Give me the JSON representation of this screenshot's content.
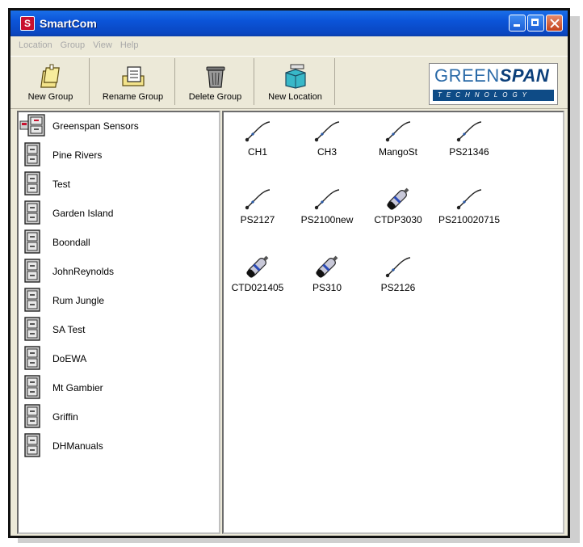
{
  "window": {
    "title": "SmartCom",
    "icon": "smartcom-app-icon"
  },
  "menu": [
    "Location",
    "Group",
    "View",
    "Help"
  ],
  "toolbar": {
    "new_group": "New Group",
    "rename_group": "Rename Group",
    "delete_group": "Delete Group",
    "new_location": "New Location"
  },
  "logo": {
    "green": "GREEN",
    "span": "SPAN",
    "tagline": "TECHNOLOGY"
  },
  "groups": [
    "Greenspan Sensors",
    "Pine Rivers",
    "Test",
    "Garden Island",
    "Boondall",
    "JohnReynolds",
    "Rum Jungle",
    "SA Test",
    "DoEWA",
    "Mt Gambier",
    "Griffin",
    "DHManuals"
  ],
  "sensors": [
    {
      "name": "CH1",
      "icon": "cable-sensor-icon"
    },
    {
      "name": "CH3",
      "icon": "cable-sensor-icon"
    },
    {
      "name": "MangoSt",
      "icon": "cable-sensor-icon"
    },
    {
      "name": "PS21346",
      "icon": "cable-sensor-icon"
    },
    {
      "name": "PS2127",
      "icon": "cable-sensor-icon"
    },
    {
      "name": "PS2100new",
      "icon": "cable-sensor-icon"
    },
    {
      "name": "CTDP3030",
      "icon": "probe-sensor-icon"
    },
    {
      "name": "PS210020715",
      "icon": "cable-sensor-icon"
    },
    {
      "name": "CTD021405",
      "icon": "probe-sensor-icon"
    },
    {
      "name": "PS310",
      "icon": "probe-sensor-icon"
    },
    {
      "name": "PS2126",
      "icon": "cable-sensor-icon"
    }
  ],
  "colors": {
    "titlebar": "#0b54d8",
    "logo_blue": "#0e4b86"
  }
}
